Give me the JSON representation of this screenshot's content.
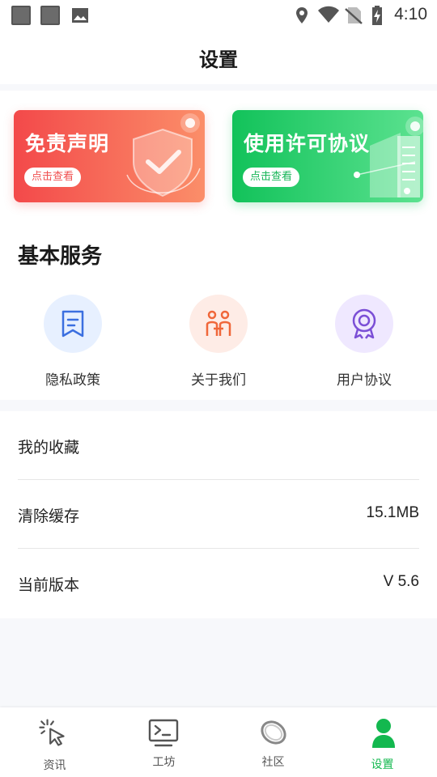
{
  "status_bar": {
    "time": "4:10"
  },
  "header": {
    "title": "设置"
  },
  "cards": [
    {
      "title": "免责声明",
      "button_label": "点击查看"
    },
    {
      "title": "使用许可协议",
      "button_label": "点击查看"
    }
  ],
  "basic_services": {
    "title": "基本服务",
    "items": [
      {
        "label": "隐私政策",
        "icon": "bookmark-icon"
      },
      {
        "label": "关于我们",
        "icon": "people-icon"
      },
      {
        "label": "用户协议",
        "icon": "award-icon"
      }
    ]
  },
  "settings_list": [
    {
      "label": "我的收藏",
      "value": ""
    },
    {
      "label": "清除缓存",
      "value": "15.1MB"
    },
    {
      "label": "当前版本",
      "value": "V 5.6"
    }
  ],
  "tabbar": {
    "active": 3,
    "tabs": [
      {
        "label": "资讯",
        "icon": "cursor-click-icon"
      },
      {
        "label": "工坊",
        "icon": "terminal-icon"
      },
      {
        "label": "社区",
        "icon": "ring-icon"
      },
      {
        "label": "设置",
        "icon": "user-icon"
      }
    ]
  },
  "colors": {
    "accent_green": "#13b84f",
    "card_red_start": "#f3494a",
    "card_red_end": "#fb8e69",
    "card_green_start": "#12c25a",
    "card_green_end": "#5ce290"
  }
}
